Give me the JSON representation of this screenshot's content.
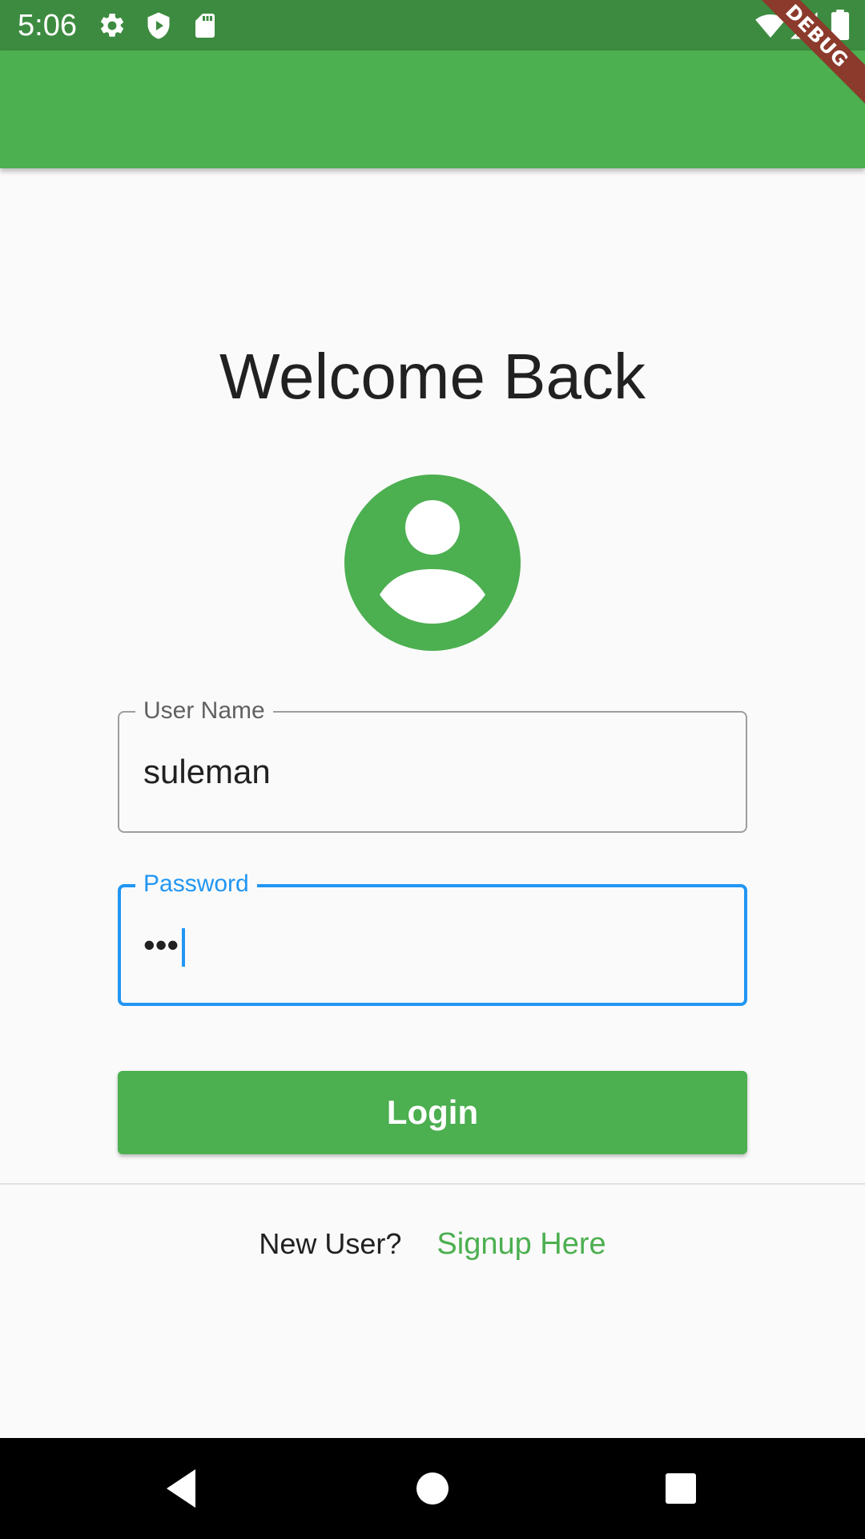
{
  "status_bar": {
    "time": "5:06",
    "left_icons": [
      "settings-icon",
      "shield-play-icon",
      "sd-card-icon"
    ],
    "right_icons": [
      "wifi-icon",
      "signal-icon",
      "battery-icon"
    ]
  },
  "debug_banner": "DEBUG",
  "title": "Welcome Back",
  "avatar_icon": "account-circle-icon",
  "username_field": {
    "label": "User Name",
    "value": "suleman"
  },
  "password_field": {
    "label": "Password",
    "value": "•••"
  },
  "login_button": "Login",
  "signup": {
    "prompt": "New User?",
    "link": "Signup Here"
  },
  "nav_bar": [
    "back-icon",
    "home-icon",
    "recents-icon"
  ],
  "colors": {
    "primary": "#4caf50",
    "status_bar": "#3d8b40",
    "focus": "#2196f3"
  }
}
